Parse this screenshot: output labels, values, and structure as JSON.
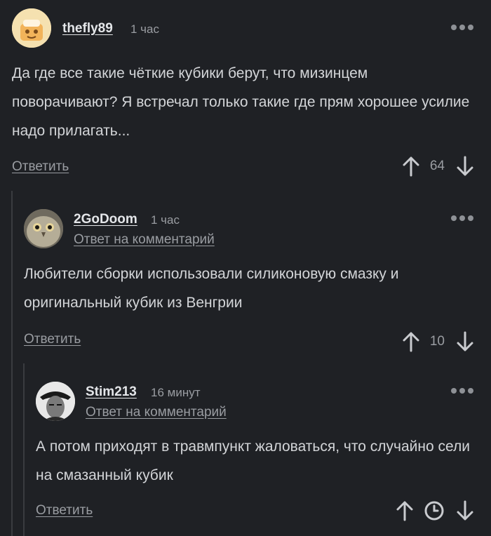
{
  "comments": [
    {
      "username": "thefly89",
      "time": "1 час",
      "text": "Да где все такие чёткие кубики берут, что мизинцем поворачивают? Я встречал только такие где прям хорошее усилие надо прилагать...",
      "reply_label": "Ответить",
      "score": "64"
    },
    {
      "username": "2GoDoom",
      "time": "1 час",
      "reply_to_label": "Ответ на комментарий",
      "text": "Любители сборки использовали силиконовую смазку и оригинальный кубик из Венгрии",
      "reply_label": "Ответить",
      "score": "10"
    },
    {
      "username": "Stim213",
      "time": "16 минут",
      "reply_to_label": "Ответ на комментарий",
      "text": "А потом приходят в травмпункт жаловаться, что случайно сели на смазанный кубик",
      "reply_label": "Ответить",
      "score_state": "clock-icon"
    }
  ],
  "colors": {
    "background": "#1f2125",
    "text": "#d3d5d8",
    "muted": "#9a9da2",
    "thread_line": "#3a3c40"
  }
}
